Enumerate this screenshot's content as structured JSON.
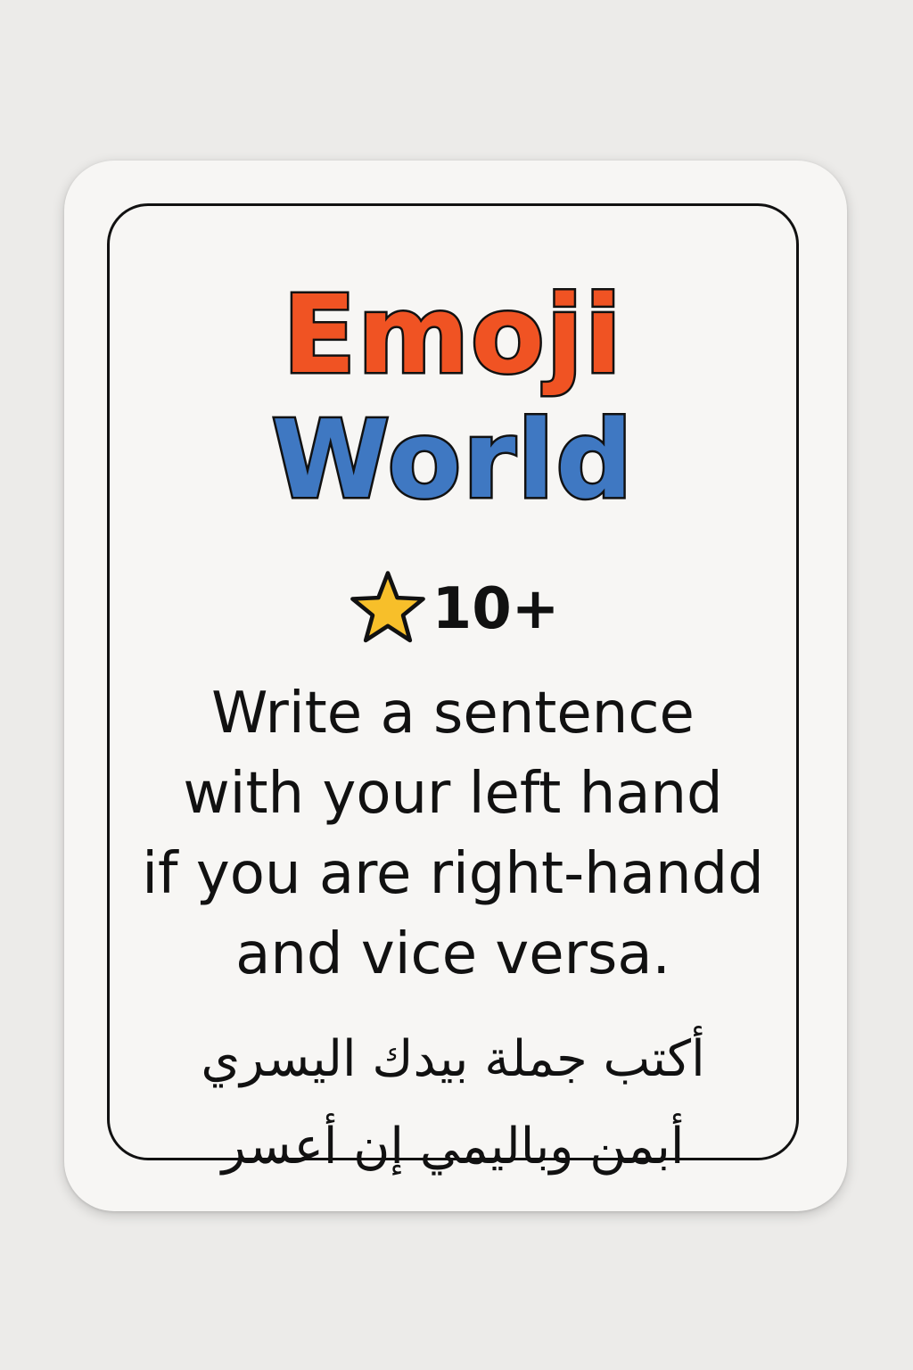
{
  "card": {
    "title_line1": "Emoji",
    "title_line2": "World",
    "rating": {
      "icon": "star-icon",
      "age": "10+"
    },
    "instruction_en": [
      "Write a sentence",
      "with your left hand",
      "if you are right-handd",
      "and vice versa."
    ],
    "instruction_ar": [
      "أكتب جملة بيدك اليسري",
      "أبمن وباليمي إن أعسر"
    ]
  },
  "colors": {
    "title_orange": "#f05323",
    "title_blue": "#3f78c2",
    "star_yellow": "#f7bf2a",
    "outline": "#111111",
    "card": "#f7f6f4",
    "background": "#ecebe9"
  }
}
